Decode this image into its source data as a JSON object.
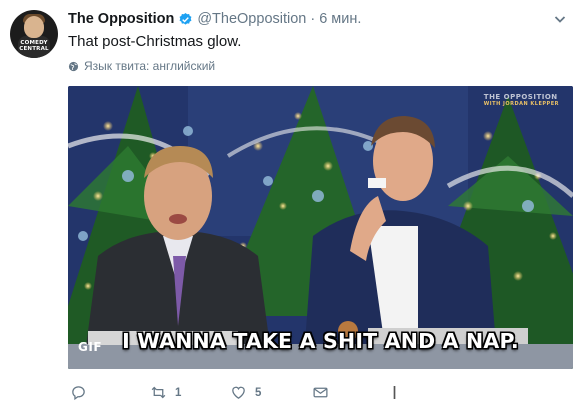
{
  "avatar": {
    "logo_line1": "COMEDY",
    "logo_line2": "CENTRAL"
  },
  "tweet": {
    "name": "The Opposition",
    "handle": "@TheOpposition",
    "time": "· 6 мин.",
    "text": "That post-Christmas glow.",
    "language_note": "Язык твита: английский"
  },
  "media": {
    "badge": "GIF",
    "caption": "I WANNA TAKE A SHIT AND A NAP.",
    "watermark_line1": "THE OPPOSITION",
    "watermark_line2": "WITH JORDAN KLEPPER"
  },
  "actions": {
    "reply_count": "",
    "retweet_count": "1",
    "like_count": "5"
  },
  "icons": {
    "verified": "verified-badge-icon",
    "chevron": "chevron-down-icon",
    "globe": "globe-icon",
    "reply": "reply-icon",
    "retweet": "retweet-icon",
    "like": "heart-icon",
    "message": "envelope-icon",
    "cursor": "text-cursor-icon"
  },
  "colors": {
    "brand": "#1da1f2",
    "secondary_text": "#657786",
    "primary_text": "#14171a"
  }
}
